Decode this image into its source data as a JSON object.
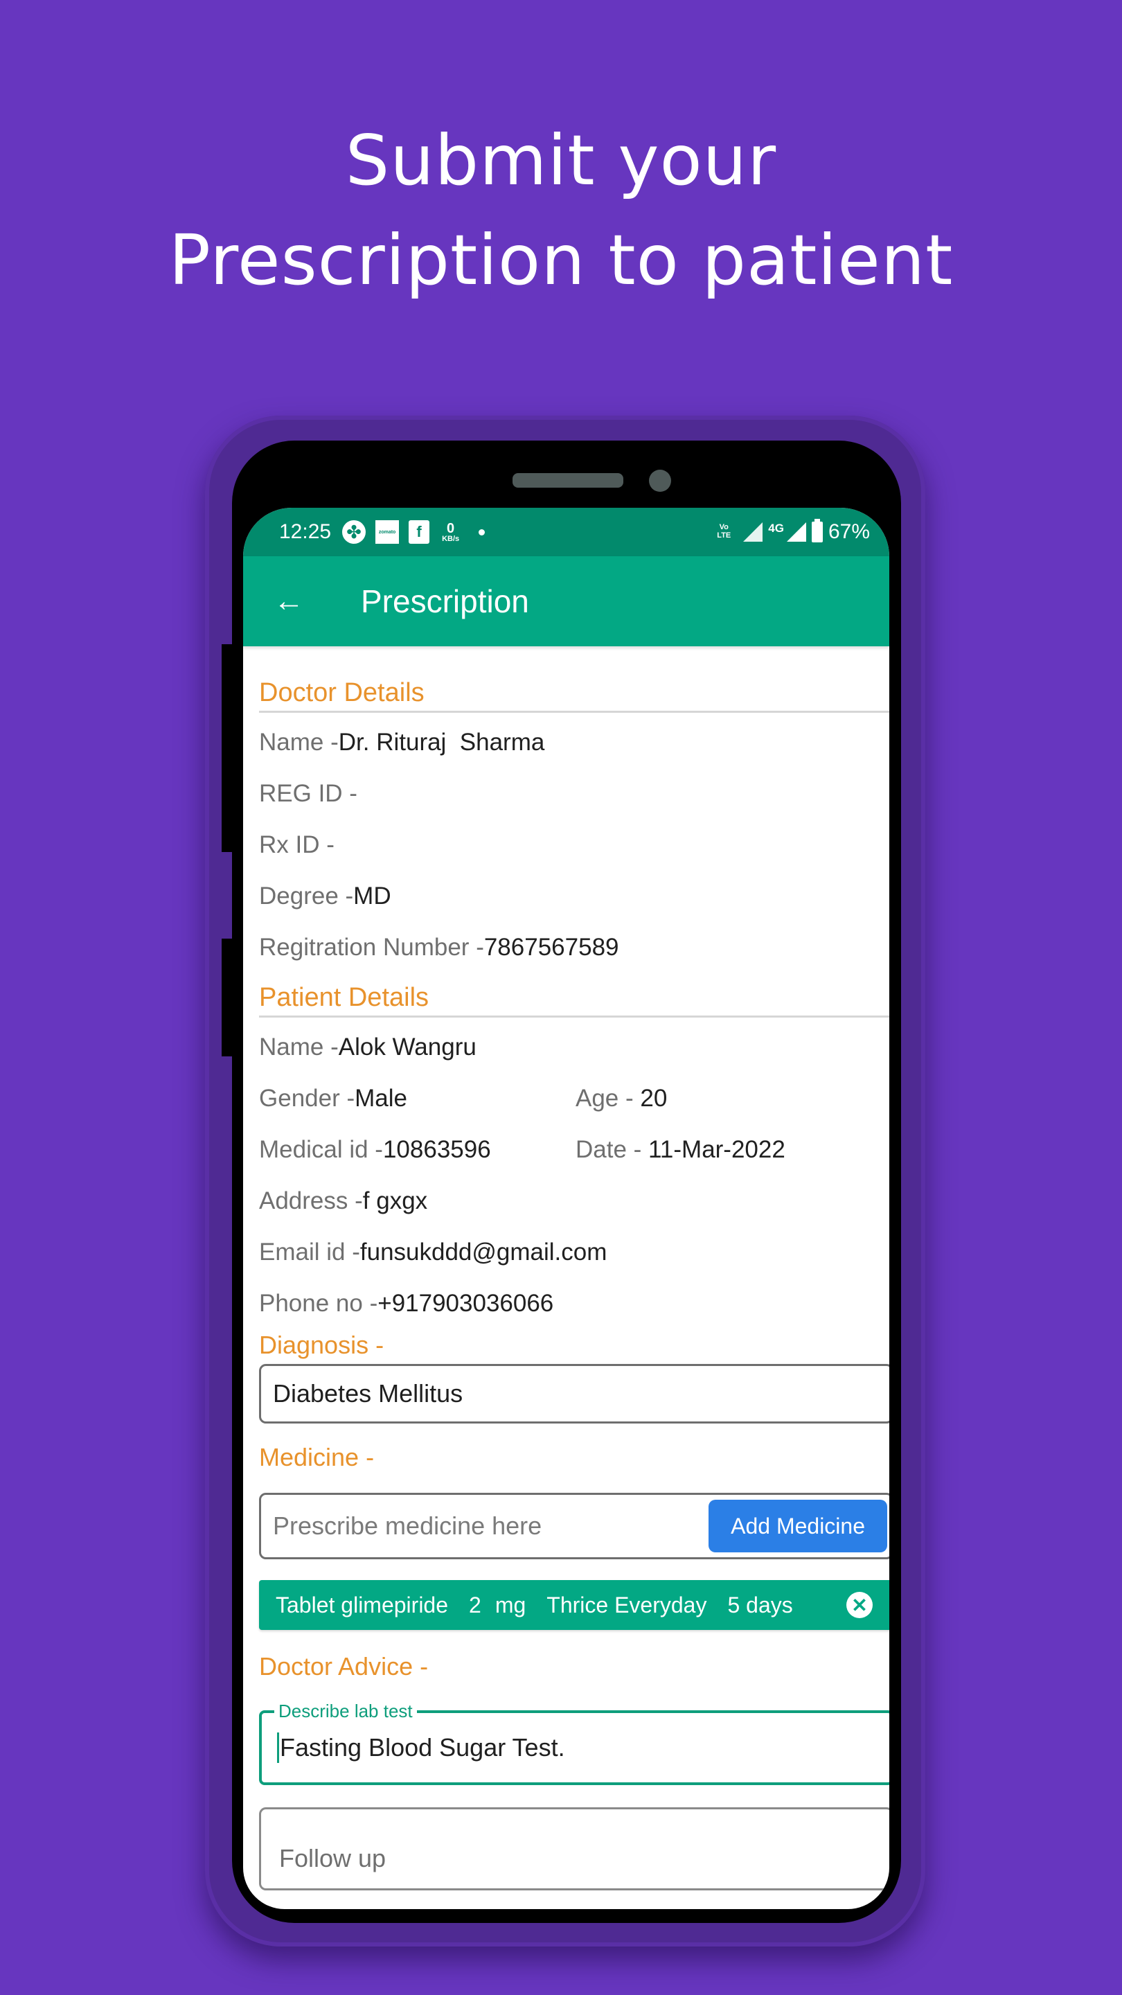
{
  "headline": {
    "line1": "Submit your",
    "line2": "Prescription to patient"
  },
  "status_bar": {
    "time": "12:25",
    "notification_icons": [
      "fan-app-icon",
      "zomato-icon",
      "shopping-bag-icon"
    ],
    "zomato_text": "zomato",
    "net_speed_value": "0",
    "net_speed_unit": "KB/s",
    "volte_top": "Vo",
    "volte_bottom": "LTE",
    "network_type": "4G",
    "battery": "67%"
  },
  "app_bar": {
    "title": "Prescription",
    "back_icon": "arrow-left-icon"
  },
  "doctor_details": {
    "heading": "Doctor Details",
    "fields": [
      {
        "label": "Name - ",
        "value": "Dr. Rituraj  Sharma"
      },
      {
        "label": "REG ID - ",
        "value": ""
      },
      {
        "label": "Rx ID - ",
        "value": ""
      },
      {
        "label": "Degree - ",
        "value": "MD"
      },
      {
        "label": "Regitration Number - ",
        "value": "7867567589"
      }
    ]
  },
  "patient_details": {
    "heading": "Patient Details",
    "name": {
      "label": "Name - ",
      "value": "Alok Wangru"
    },
    "gender": {
      "label": "Gender - ",
      "value": "Male"
    },
    "age": {
      "label": "Age - ",
      "value": "20"
    },
    "medical_id": {
      "label": "Medical id - ",
      "value": "10863596"
    },
    "date": {
      "label": "Date - ",
      "value": "11-Mar-2022"
    },
    "address": {
      "label": "Address - ",
      "value": "f gxgx"
    },
    "email": {
      "label": "Email id - ",
      "value": "funsukddd@gmail.com"
    },
    "phone": {
      "label": "Phone no - ",
      "value": "+917903036066"
    }
  },
  "diagnosis": {
    "label": "Diagnosis -",
    "value": "Diabetes Mellitus"
  },
  "medicine": {
    "label": "Medicine -",
    "input_placeholder": "Prescribe medicine here",
    "add_button": "Add Medicine",
    "items": [
      {
        "name": "Tablet glimepiride",
        "dose": "2",
        "unit": "mg",
        "frequency": "Thrice Everyday",
        "duration": "5 days"
      }
    ]
  },
  "doctor_advice": {
    "label": "Doctor Advice -",
    "lab_test_label": "Describe lab test",
    "lab_test_value": "Fasting Blood Sugar Test.",
    "follow_up_placeholder": "Follow up"
  },
  "colors": {
    "background": "#6736bf",
    "status_bar": "#028a6c",
    "app_bar": "#03a884",
    "section_heading": "#e8922c",
    "add_button": "#2b7fe6",
    "focused_outline": "#0e9e7c"
  }
}
